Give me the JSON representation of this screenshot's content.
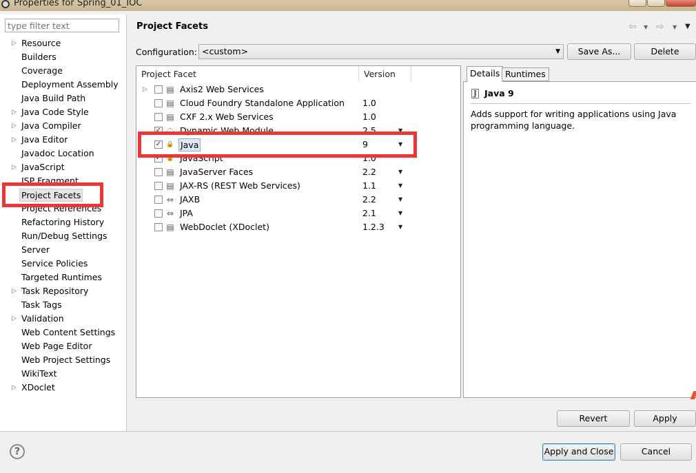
{
  "window": {
    "title": "Properties for Spring_01_IOC"
  },
  "filter": {
    "placeholder": "type filter text"
  },
  "nav": {
    "items": [
      {
        "label": "Resource",
        "expandable": true
      },
      {
        "label": "Builders",
        "expandable": false
      },
      {
        "label": "Coverage",
        "expandable": false
      },
      {
        "label": "Deployment Assembly",
        "expandable": false
      },
      {
        "label": "Java Build Path",
        "expandable": false
      },
      {
        "label": "Java Code Style",
        "expandable": true
      },
      {
        "label": "Java Compiler",
        "expandable": true
      },
      {
        "label": "Java Editor",
        "expandable": true
      },
      {
        "label": "Javadoc Location",
        "expandable": false
      },
      {
        "label": "JavaScript",
        "expandable": true
      },
      {
        "label": "JSP Fragment",
        "expandable": false
      },
      {
        "label": "Project Facets",
        "expandable": false,
        "selected": true
      },
      {
        "label": "Project References",
        "expandable": false
      },
      {
        "label": "Refactoring History",
        "expandable": false
      },
      {
        "label": "Run/Debug Settings",
        "expandable": false
      },
      {
        "label": "Server",
        "expandable": false
      },
      {
        "label": "Service Policies",
        "expandable": false
      },
      {
        "label": "Targeted Runtimes",
        "expandable": false
      },
      {
        "label": "Task Repository",
        "expandable": true
      },
      {
        "label": "Task Tags",
        "expandable": false
      },
      {
        "label": "Validation",
        "expandable": true
      },
      {
        "label": "Web Content Settings",
        "expandable": false
      },
      {
        "label": "Web Page Editor",
        "expandable": false
      },
      {
        "label": "Web Project Settings",
        "expandable": false
      },
      {
        "label": "WikiText",
        "expandable": false
      },
      {
        "label": "XDoclet",
        "expandable": true
      }
    ]
  },
  "page": {
    "title": "Project Facets",
    "configuration_label": "Configuration:",
    "configuration_value": "<custom>",
    "save_as_label": "Save As...",
    "delete_label": "Delete"
  },
  "table": {
    "col_facet": "Project Facet",
    "col_version": "Version",
    "rows": [
      {
        "name": "Axis2 Web Services",
        "version": "",
        "checked": false,
        "expandable": true,
        "icon": "page-icon",
        "dropdown": false
      },
      {
        "name": "Cloud Foundry Standalone Application",
        "version": "1.0",
        "checked": false,
        "icon": "page-icon",
        "dropdown": false
      },
      {
        "name": "CXF 2.x Web Services",
        "version": "1.0",
        "checked": false,
        "icon": "page-icon",
        "dropdown": false
      },
      {
        "name": "Dynamic Web Module",
        "version": "2.5",
        "checked": true,
        "icon": "globe-icon",
        "dropdown": true
      },
      {
        "name": "Java",
        "version": "9",
        "checked": true,
        "icon": "java-lock-icon",
        "dropdown": true,
        "selected": true
      },
      {
        "name": "JavaScript",
        "version": "1.0",
        "checked": true,
        "icon": "lock-icon",
        "dropdown": false
      },
      {
        "name": "JavaServer Faces",
        "version": "2.2",
        "checked": false,
        "icon": "page-icon",
        "dropdown": true
      },
      {
        "name": "JAX-RS (REST Web Services)",
        "version": "1.1",
        "checked": false,
        "icon": "page-icon",
        "dropdown": true
      },
      {
        "name": "JAXB",
        "version": "2.2",
        "checked": false,
        "icon": "arrows-icon",
        "dropdown": true
      },
      {
        "name": "JPA",
        "version": "2.1",
        "checked": false,
        "icon": "arrows-icon",
        "dropdown": true
      },
      {
        "name": "WebDoclet (XDoclet)",
        "version": "1.2.3",
        "checked": false,
        "icon": "page-icon",
        "dropdown": true
      }
    ]
  },
  "details": {
    "tab_details": "Details",
    "tab_runtimes": "Runtimes",
    "title": "Java 9",
    "icon_glyph": "J",
    "description": "Adds support for writing applications using Java programming language."
  },
  "buttons": {
    "revert": "Revert",
    "apply": "Apply",
    "apply_close": "Apply and Close",
    "cancel": "Cancel"
  },
  "highlight_color": "#ee3535"
}
